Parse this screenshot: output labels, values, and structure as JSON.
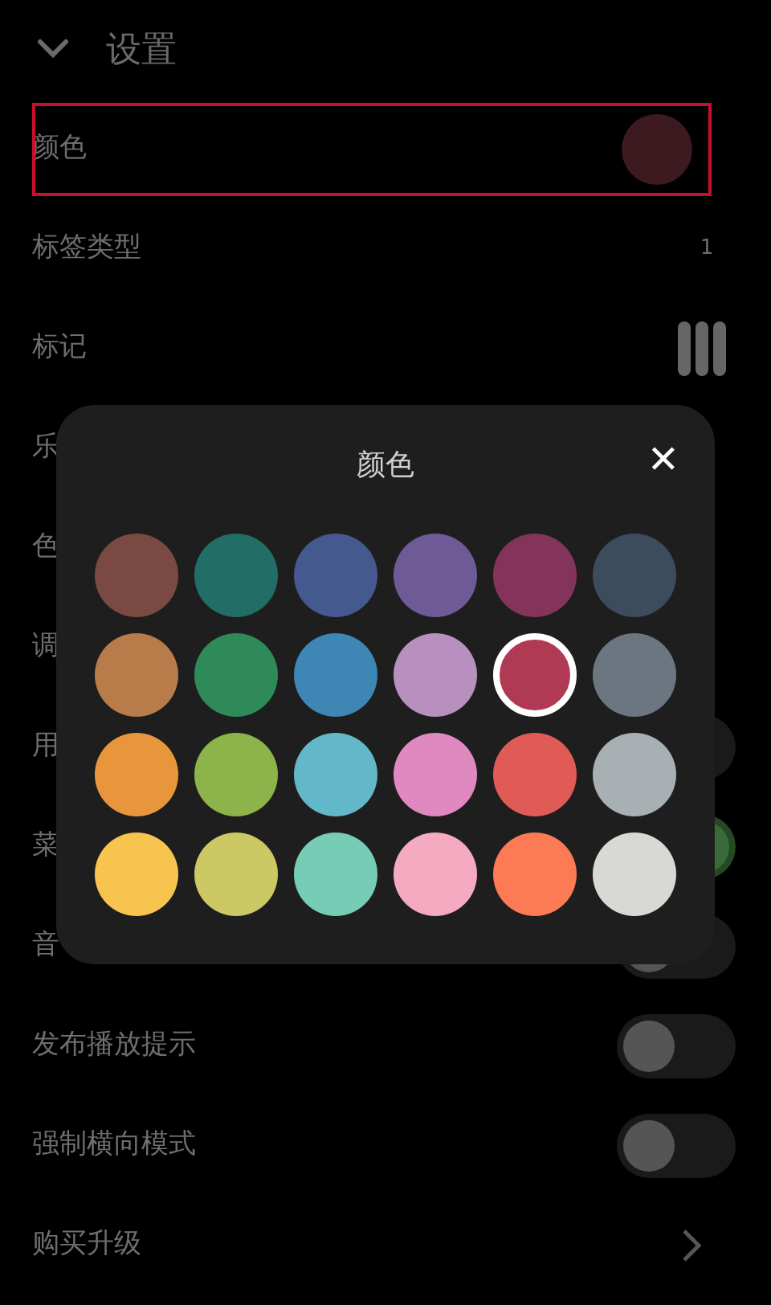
{
  "header": {
    "title": "设置",
    "expanded": true
  },
  "rows": [
    {
      "label": "颜色",
      "kind": "color",
      "color": "#3c1a20",
      "highlighted": true
    },
    {
      "label": "标签类型",
      "kind": "value",
      "value": "1",
      "highlighted": false
    },
    {
      "label": "标记",
      "kind": "bars",
      "highlighted": false
    },
    {
      "label": "乐",
      "kind": "plain",
      "highlighted": false
    },
    {
      "label": "色",
      "kind": "plain",
      "highlighted": false
    },
    {
      "label": "调",
      "kind": "plain",
      "highlighted": false
    },
    {
      "label": "用",
      "kind": "toggle",
      "on": false,
      "highlighted": false
    },
    {
      "label": "菜",
      "kind": "toggle",
      "on": true,
      "highlighted": false
    },
    {
      "label": "音",
      "kind": "toggle",
      "on": false,
      "highlighted": false
    },
    {
      "label": "发布播放提示",
      "kind": "toggle",
      "on": false,
      "highlighted": false
    },
    {
      "label": "强制横向模式",
      "kind": "toggle",
      "on": false,
      "highlighted": false
    },
    {
      "label": "购买升级",
      "kind": "chevron",
      "highlighted": false
    }
  ],
  "dialog": {
    "title": "颜色",
    "close": "✕",
    "swatches": [
      {
        "color": "#7a4a42",
        "selected": false
      },
      {
        "color": "#226e66",
        "selected": false
      },
      {
        "color": "#44598e",
        "selected": false
      },
      {
        "color": "#6e5a96",
        "selected": false
      },
      {
        "color": "#84345a",
        "selected": false
      },
      {
        "color": "#3c4c5c",
        "selected": false
      },
      {
        "color": "#b77c4a",
        "selected": false
      },
      {
        "color": "#2e8a58",
        "selected": false
      },
      {
        "color": "#3e86b4",
        "selected": false
      },
      {
        "color": "#b890c0",
        "selected": false
      },
      {
        "color": "#b03a54",
        "selected": true
      },
      {
        "color": "#6c7680",
        "selected": false
      },
      {
        "color": "#e8963c",
        "selected": false
      },
      {
        "color": "#8cb44a",
        "selected": false
      },
      {
        "color": "#62b8c8",
        "selected": false
      },
      {
        "color": "#e088c0",
        "selected": false
      },
      {
        "color": "#e05a56",
        "selected": false
      },
      {
        "color": "#a8b0b4",
        "selected": false
      },
      {
        "color": "#f8c450",
        "selected": false
      },
      {
        "color": "#ccc864",
        "selected": false
      },
      {
        "color": "#76ccb4",
        "selected": false
      },
      {
        "color": "#f4aac0",
        "selected": false
      },
      {
        "color": "#fc7a54",
        "selected": false
      },
      {
        "color": "#d8d8d4",
        "selected": false
      }
    ]
  }
}
